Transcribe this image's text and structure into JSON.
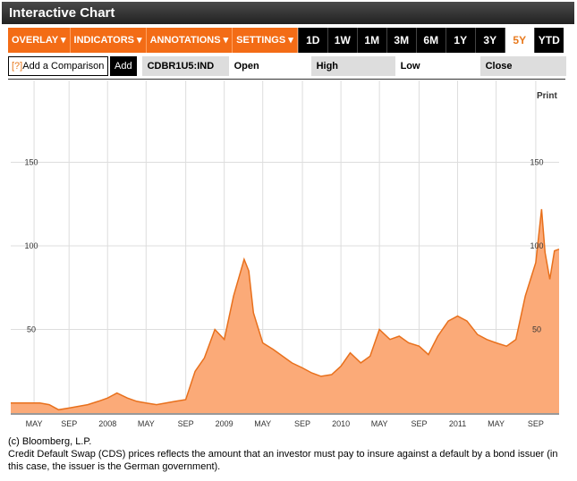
{
  "header": {
    "title": "Interactive Chart"
  },
  "toolbar": {
    "menus": [
      "OVERLAY ▾",
      "INDICATORS ▾",
      "ANNOTATIONS ▾",
      "SETTINGS ▾"
    ],
    "ranges": [
      "1D",
      "1W",
      "1M",
      "3M",
      "6M",
      "1Y",
      "3Y",
      "5Y",
      "YTD"
    ],
    "active_range": "5Y"
  },
  "comparison": {
    "help": "[?]",
    "label": "Add a Comparison",
    "add": "Add",
    "ticker": "CDBR1U5:IND",
    "open": "Open",
    "high": "High",
    "low": "Low",
    "close": "Close"
  },
  "print": "Print",
  "colors": {
    "line": "#e8701c",
    "fill": "#fbaa78",
    "accent": "#f36c16"
  },
  "chart_data": {
    "type": "area",
    "title": "CDBR1U5:IND",
    "ylim": [
      0,
      160
    ],
    "yticks": [
      50,
      100,
      150
    ],
    "xlim": [
      2007.17,
      2011.87
    ],
    "xticks": [
      {
        "x": 2007.37,
        "label": "MAY"
      },
      {
        "x": 2007.67,
        "label": "SEP"
      },
      {
        "x": 2008.0,
        "label": "2008"
      },
      {
        "x": 2008.33,
        "label": "MAY"
      },
      {
        "x": 2008.67,
        "label": "SEP"
      },
      {
        "x": 2009.0,
        "label": "2009"
      },
      {
        "x": 2009.33,
        "label": "MAY"
      },
      {
        "x": 2009.67,
        "label": "SEP"
      },
      {
        "x": 2010.0,
        "label": "2010"
      },
      {
        "x": 2010.33,
        "label": "MAY"
      },
      {
        "x": 2010.67,
        "label": "SEP"
      },
      {
        "x": 2011.0,
        "label": "2011"
      },
      {
        "x": 2011.33,
        "label": "MAY"
      },
      {
        "x": 2011.67,
        "label": "SEP"
      }
    ],
    "x": [
      2007.17,
      2007.25,
      2007.33,
      2007.42,
      2007.5,
      2007.58,
      2007.67,
      2007.75,
      2007.83,
      2007.92,
      2008.0,
      2008.08,
      2008.17,
      2008.25,
      2008.33,
      2008.42,
      2008.5,
      2008.58,
      2008.67,
      2008.75,
      2008.83,
      2008.92,
      2009.0,
      2009.08,
      2009.17,
      2009.21,
      2009.25,
      2009.33,
      2009.42,
      2009.5,
      2009.58,
      2009.67,
      2009.75,
      2009.83,
      2009.92,
      2010.0,
      2010.08,
      2010.17,
      2010.25,
      2010.33,
      2010.42,
      2010.5,
      2010.58,
      2010.67,
      2010.75,
      2010.83,
      2010.92,
      2011.0,
      2011.08,
      2011.17,
      2011.25,
      2011.33,
      2011.42,
      2011.5,
      2011.58,
      2011.67,
      2011.72,
      2011.75,
      2011.79,
      2011.83,
      2011.87
    ],
    "values": [
      6,
      6,
      6,
      6,
      5,
      2,
      3,
      4,
      5,
      7,
      9,
      12,
      9,
      7,
      6,
      5,
      6,
      7,
      8,
      25,
      33,
      50,
      44,
      70,
      92,
      85,
      60,
      42,
      38,
      34,
      30,
      27,
      24,
      22,
      23,
      28,
      36,
      30,
      34,
      50,
      44,
      46,
      42,
      40,
      35,
      46,
      55,
      58,
      55,
      47,
      44,
      42,
      40,
      44,
      70,
      90,
      122,
      96,
      80,
      97,
      98
    ]
  },
  "footer": {
    "copyright": "(c) Bloomberg, L.P.",
    "description": "Credit Default Swap (CDS) prices reflects the amount that an investor must pay to insure against a default by a bond issuer (in this case, the issuer is the German government)."
  }
}
